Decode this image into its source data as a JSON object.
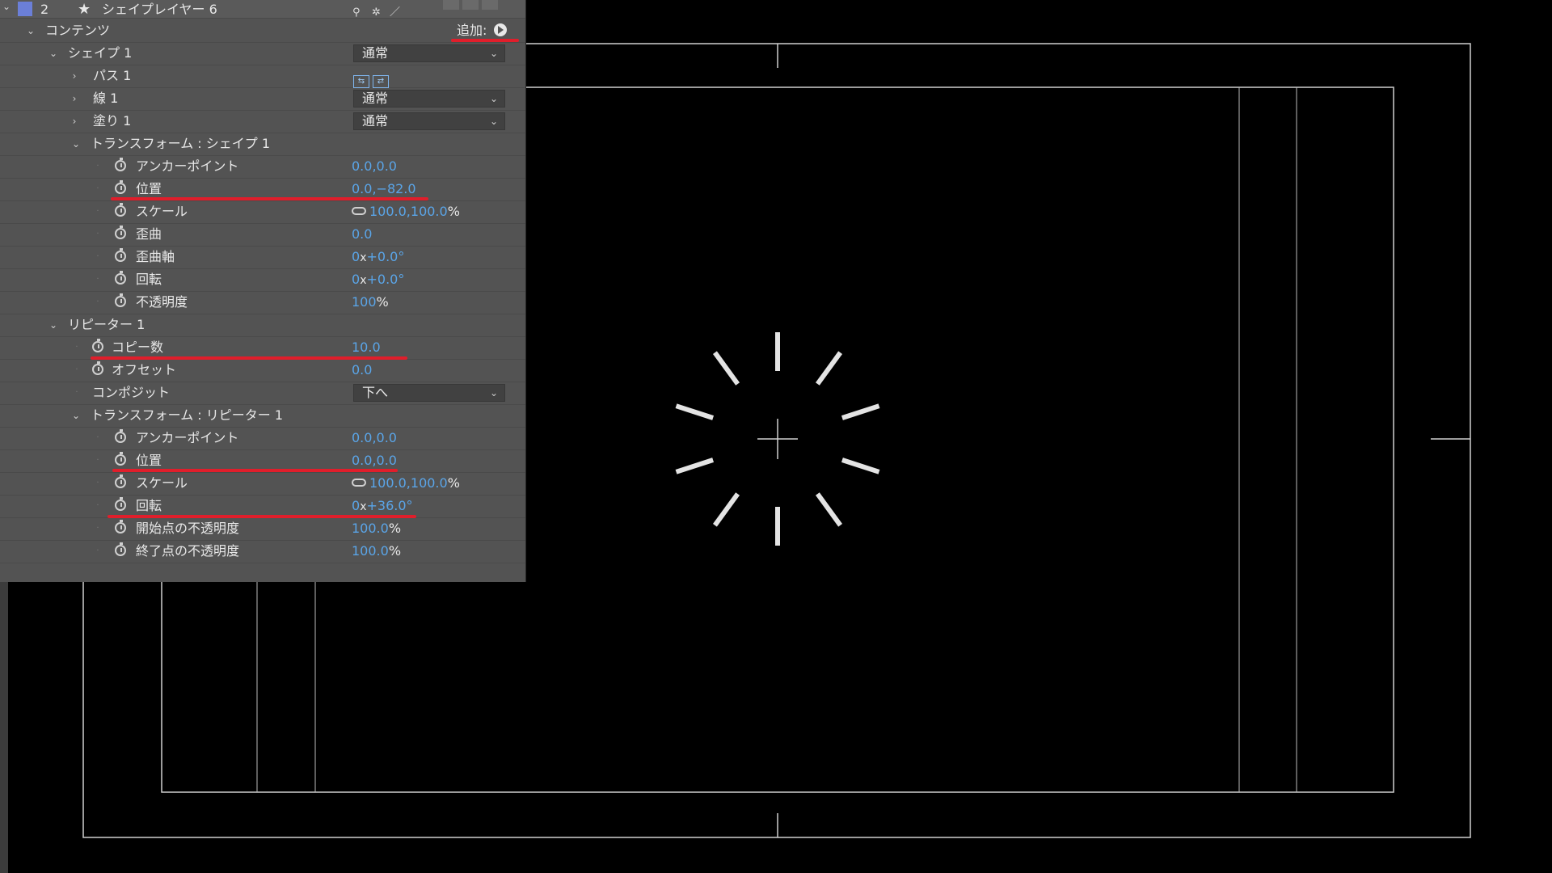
{
  "layer": {
    "number": "2",
    "name": "シェイプレイヤー 6",
    "color": "#6b7fd8"
  },
  "contents": {
    "label": "コンテンツ",
    "add_label": "追加:"
  },
  "shape": {
    "label": "シェイプ 1",
    "blend": "通常",
    "path_label": "パス 1",
    "stroke_label": "線 1",
    "stroke_blend": "通常",
    "fill_label": "塗り 1",
    "fill_blend": "通常"
  },
  "shape_transform": {
    "label": "トランスフォーム : シェイプ 1",
    "anchor": {
      "label": "アンカーポイント",
      "value": "0.0,0.0"
    },
    "position": {
      "label": "位置",
      "value": "0.0,−82.0"
    },
    "scale": {
      "label": "スケール",
      "value": "100.0,100.0",
      "unit": "%"
    },
    "skew": {
      "label": "歪曲",
      "value": "0.0"
    },
    "skew_axis": {
      "label": "歪曲軸",
      "turns": "0",
      "x": "x",
      "value": "+0.0°"
    },
    "rotation": {
      "label": "回転",
      "turns": "0",
      "x": "x",
      "value": "+0.0°"
    },
    "opacity": {
      "label": "不透明度",
      "value": "100",
      "unit": "%"
    }
  },
  "repeater": {
    "label": "リピーター 1",
    "copies": {
      "label": "コピー数",
      "value": "10.0"
    },
    "offset": {
      "label": "オフセット",
      "value": "0.0"
    },
    "composite": {
      "label": "コンポジット",
      "value": "下へ"
    }
  },
  "repeater_transform": {
    "label": "トランスフォーム : リピーター 1",
    "anchor": {
      "label": "アンカーポイント",
      "value": "0.0,0.0"
    },
    "position": {
      "label": "位置",
      "value": "0.0,0.0"
    },
    "scale": {
      "label": "スケール",
      "value": "100.0,100.0",
      "unit": "%"
    },
    "rotation": {
      "label": "回転",
      "turns": "0",
      "x": "x",
      "value": "+36.0°"
    },
    "start_opacity": {
      "label": "開始点の不透明度",
      "value": "100.0",
      "unit": "%"
    },
    "end_opacity": {
      "label": "終了点の不透明度",
      "value": "100.0",
      "unit": "%"
    }
  },
  "highlight_color": "#e01e2b",
  "value_color": "#5aa5e8"
}
